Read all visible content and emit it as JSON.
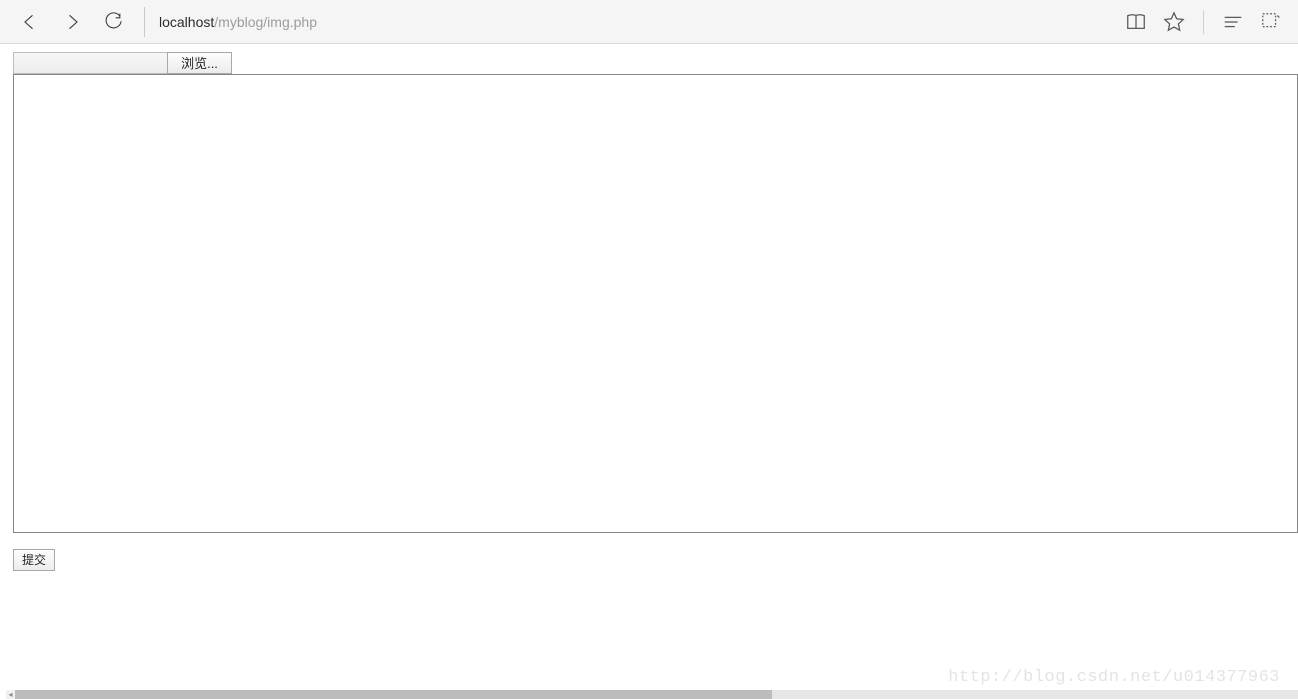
{
  "browser": {
    "address": {
      "host": "localhost",
      "path": "/myblog/img.php"
    }
  },
  "page": {
    "file_input": {
      "filename": "",
      "browse_label": "浏览..."
    },
    "textarea_value": "",
    "submit_label": "提交"
  },
  "watermark": "http://blog.csdn.net/u014377963"
}
